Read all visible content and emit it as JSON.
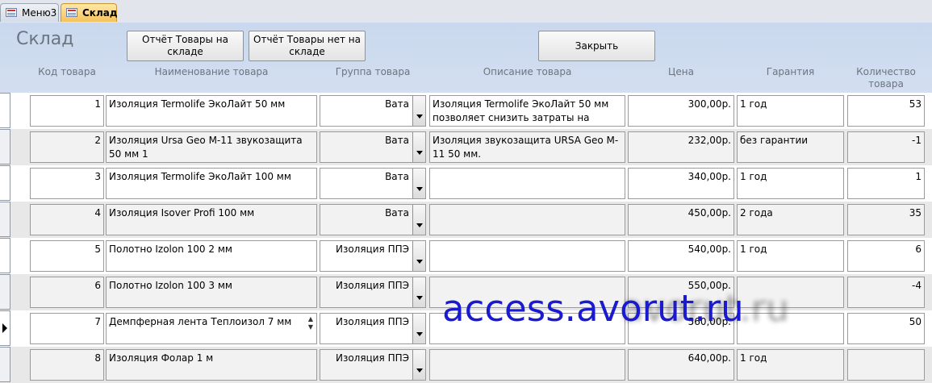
{
  "tabs": [
    {
      "label": "Меню3",
      "active": false
    },
    {
      "label": "Склад",
      "active": true
    }
  ],
  "header": {
    "title": "Склад",
    "buttons": {
      "report_in_stock": "Отчёт Товары на складе",
      "report_not_in_stock": "Отчёт Товары нет на складе",
      "close": "Закрыть"
    },
    "columns": {
      "code": "Код товара",
      "name": "Наименование товара",
      "group": "Группа товара",
      "description": "Описание товара",
      "price": "Цена",
      "warranty": "Гарантия",
      "quantity": "Количество товара"
    }
  },
  "rows": [
    {
      "code": "1",
      "name": "Изоляция Termolife ЭкоЛайт 50 мм",
      "group": "Вата",
      "description": "Изоляция Termolife ЭкоЛайт 50 мм  позволяет снизить затраты на",
      "price": "300,00р.",
      "warranty": "1 год",
      "quantity": "53"
    },
    {
      "code": "2",
      "name": "Изоляция Ursa Geo M-11 звукозащита 50 мм 1",
      "group": "Вата",
      "description": "Изоляция звукозащита URSA Geo M-11 50 мм.",
      "price": "232,00р.",
      "warranty": "без гарантии",
      "quantity": "-1"
    },
    {
      "code": "3",
      "name": "Изоляция Termolife ЭкоЛайт 100 мм",
      "group": "Вата",
      "description": "",
      "price": "340,00р.",
      "warranty": "1 год",
      "quantity": "1"
    },
    {
      "code": "4",
      "name": "Изоляция Isover Profi 100 мм",
      "group": "Вата",
      "description": "",
      "price": "450,00р.",
      "warranty": "2 года",
      "quantity": "35"
    },
    {
      "code": "5",
      "name": "Полотно Izolon 100 2 мм",
      "group": "Изоляция ППЭ",
      "description": "",
      "price": "540,00р.",
      "warranty": "1 год",
      "quantity": "6"
    },
    {
      "code": "6",
      "name": "Полотно Izolon 100 3 мм",
      "group": "Изоляция ППЭ",
      "description": "",
      "price": "550,00р.",
      "warranty": "",
      "quantity": "-4"
    },
    {
      "code": "7",
      "name": "Демпферная лента Теплоизол 7 мм",
      "group": "Изоляция ППЭ",
      "description": "",
      "price": "560,00р.",
      "warranty": "",
      "quantity": "50"
    },
    {
      "code": "8",
      "name": "Изоляция Фолар 1 м",
      "group": "Изоляция ППЭ",
      "description": "",
      "price": "640,00р.",
      "warranty": "1 год",
      "quantity": ""
    }
  ],
  "watermark": "access.avorut.ru",
  "watermark_shadow": "avorut.ru"
}
